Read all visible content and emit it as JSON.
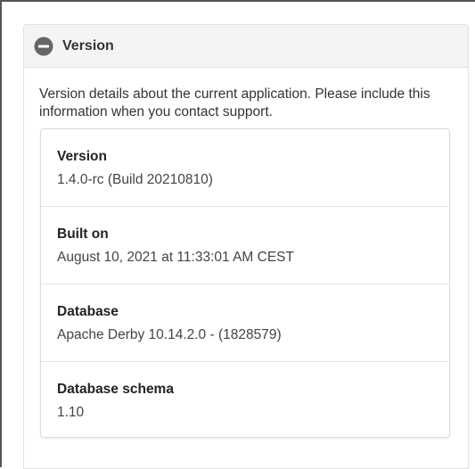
{
  "panel": {
    "title": "Version",
    "icon": "minus-circle-icon",
    "description": "Version details about the current application. Please include this information when you contact support."
  },
  "details": [
    {
      "label": "Version",
      "value": "1.4.0-rc (Build 20210810)"
    },
    {
      "label": "Built on",
      "value": "August 10, 2021 at 11:33:01 AM CEST"
    },
    {
      "label": "Database",
      "value": "Apache Derby 10.14.2.0 - (1828579)"
    },
    {
      "label": "Database schema",
      "value": "1.10"
    }
  ],
  "colors": {
    "icon": "#666666",
    "header_bg": "#f4f4f4",
    "border": "#e1e1e1"
  }
}
